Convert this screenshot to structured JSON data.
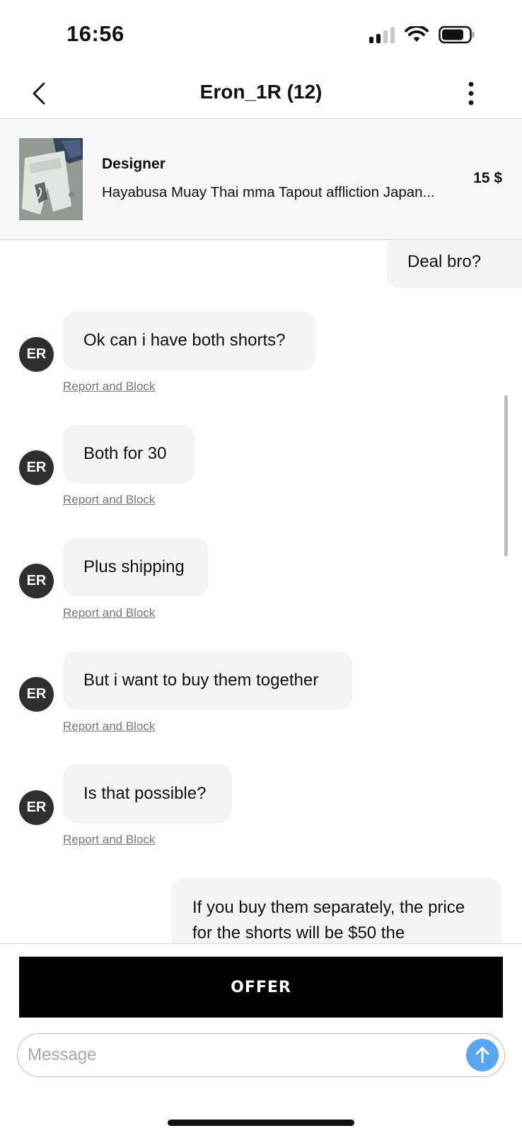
{
  "status_bar": {
    "time": "16:56",
    "signal_icon": "signal-bars-icon",
    "wifi_icon": "wifi-icon",
    "battery_icon": "battery-icon"
  },
  "header": {
    "title": "Eron_1R (12)",
    "back_icon": "chevron-left-icon",
    "more_icon": "vertical-dots-icon"
  },
  "product": {
    "brand": "Designer",
    "name": "Hayabusa Muay Thai mma Tapout affliction Japan...",
    "price": "15 $"
  },
  "messages": [
    {
      "from": "me",
      "text": "Deal bro?"
    },
    {
      "from": "them",
      "avatar": "ER",
      "text": "Ok can i have both shorts?",
      "report": "Report and Block"
    },
    {
      "from": "them",
      "avatar": "ER",
      "text": "Both for 30",
      "report": "Report and Block"
    },
    {
      "from": "them",
      "avatar": "ER",
      "text": "Plus shipping",
      "report": "Report and Block"
    },
    {
      "from": "them",
      "avatar": "ER",
      "text": "But i want to buy them together",
      "report": "Report and Block"
    },
    {
      "from": "them",
      "avatar": "ER",
      "text": "Is that possible?",
      "report": "Report and Block"
    },
    {
      "from": "me",
      "text": "If you buy them separately, the price for the shorts will be $50 the"
    }
  ],
  "composer": {
    "offer_label": "OFFER",
    "message_placeholder": "Message",
    "send_icon": "arrow-up-icon"
  },
  "colors": {
    "send_button": "#5aa7f0",
    "bubble": "#f3f3f3",
    "avatar": "#2f2f2f",
    "offer_button": "#000000"
  }
}
